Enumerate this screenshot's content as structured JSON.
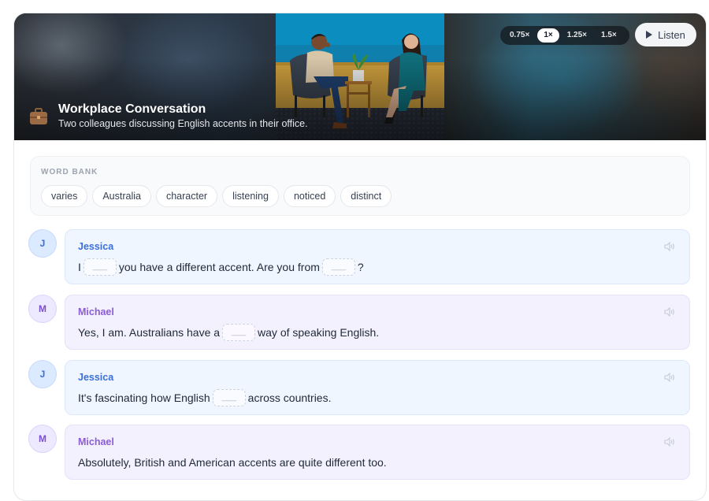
{
  "hero": {
    "title": "Workplace Conversation",
    "subtitle": "Two colleagues discussing English accents in their office.",
    "icon": "briefcase-icon",
    "speeds": [
      "0.75×",
      "1×",
      "1.25×",
      "1.5×"
    ],
    "active_speed": "1×",
    "listen_label": "Listen"
  },
  "word_bank": {
    "label": "WORD BANK",
    "words": [
      "varies",
      "Australia",
      "character",
      "listening",
      "noticed",
      "distinct"
    ]
  },
  "blank_placeholder": "___",
  "messages": [
    {
      "speaker": "Jessica",
      "initial": "J",
      "parts": [
        "I",
        "you have a different accent. Are you from",
        "?"
      ]
    },
    {
      "speaker": "Michael",
      "initial": "M",
      "parts": [
        "Yes, I am. Australians have a",
        "way of speaking English."
      ]
    },
    {
      "speaker": "Jessica",
      "initial": "J",
      "parts": [
        "It's fascinating how English",
        "across countries."
      ]
    },
    {
      "speaker": "Michael",
      "initial": "M",
      "parts": [
        "Absolutely, British and American accents are quite different too."
      ]
    }
  ],
  "colors": {
    "jessica_accent": "#3b6fd8",
    "michael_accent": "#8b5cd6",
    "jessica_bubble": "#eff6ff",
    "michael_bubble": "#f4f1fe"
  }
}
